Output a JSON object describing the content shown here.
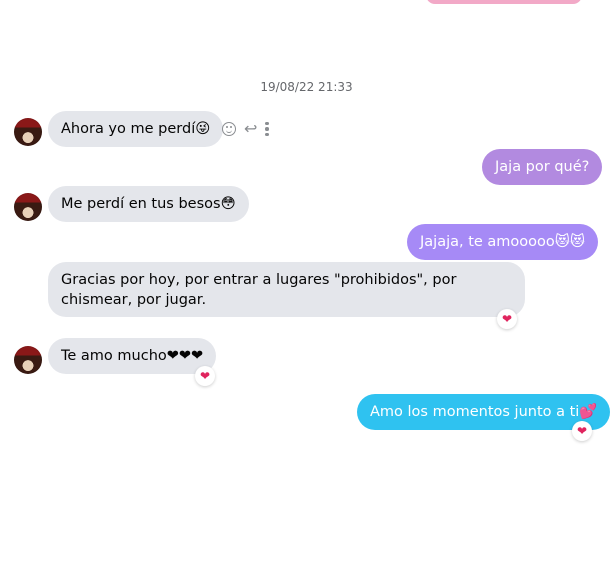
{
  "chat": {
    "timestamp": "19/08/22 21:33",
    "messages": [
      {
        "sender": "them",
        "text": "Ahora yo me perdí😜"
      },
      {
        "sender": "me",
        "text": "Jaja por qué?"
      },
      {
        "sender": "them",
        "text": "Me perdí en tus besos😳"
      },
      {
        "sender": "me",
        "text": "Jajaja, te amooooo😻😻"
      },
      {
        "sender": "them",
        "text": "Gracias por hoy, por entrar a lugares \"prohibidos\", por chismear, por jugar.",
        "reaction": "❤"
      },
      {
        "sender": "them",
        "text": "Te amo mucho❤❤❤",
        "reaction": "❤"
      },
      {
        "sender": "me",
        "text": "Amo los momentos junto a ti💕",
        "reaction": "❤"
      }
    ]
  },
  "colors": {
    "incoming_bubble": "#e4e6eb",
    "outgoing_purple": "#b28ae0",
    "outgoing_violet": "#a68af6",
    "outgoing_blue": "#2fc2f0",
    "reaction_heart": "#e0245e"
  },
  "icons": {
    "react": "smile-icon",
    "reply": "reply-icon",
    "more": "more-dots-icon"
  }
}
